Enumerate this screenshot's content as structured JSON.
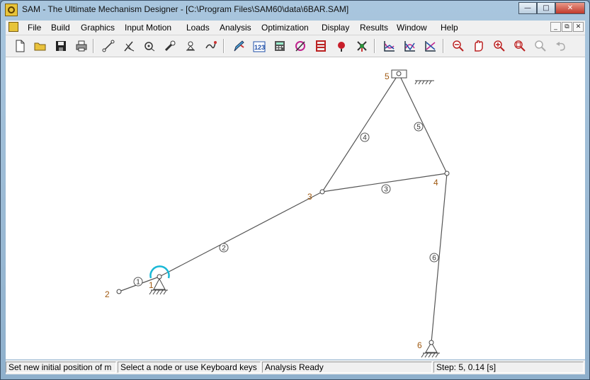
{
  "window": {
    "title": "SAM - The Ultimate Mechanism Designer - [C:\\Program Files\\SAM60\\data\\6BAR.SAM]"
  },
  "menu": [
    "File",
    "Build",
    "Graphics",
    "Input Motion",
    "Loads",
    "Analysis",
    "Optimization",
    "Display",
    "Results",
    "Window",
    "Help"
  ],
  "toolbar_icons": [
    "new-file-icon",
    "open-folder-icon",
    "save-icon",
    "print-icon",
    "beam-icon",
    "slider-icon",
    "hinge-icon",
    "gear-icon",
    "ground-icon",
    "spring-icon",
    "pen-icon",
    "numbers-123-icon",
    "calculator-icon",
    "pulley-icon",
    "ladder-icon",
    "load-icon",
    "windmill-icon",
    "chart-1-icon",
    "chart-2-icon",
    "chart-3-icon",
    "zoom-out-icon",
    "pan-icon",
    "zoom-fit-icon",
    "zoom-window-icon",
    "zoom-previous-icon",
    "undo-icon"
  ],
  "mechanism": {
    "nodes": [
      {
        "label": "1",
        "pos": "lower"
      },
      {
        "label": "2",
        "pos": "left"
      },
      {
        "label": "3",
        "pos": "left"
      },
      {
        "label": "4",
        "pos": "lower"
      },
      {
        "label": "5",
        "pos": "left"
      },
      {
        "label": "6",
        "pos": "left"
      }
    ],
    "elements": [
      "1",
      "2",
      "3",
      "4",
      "5",
      "6"
    ]
  },
  "status": {
    "pane1": "Set new initial position of m",
    "pane2": "Select a node or use Keyboard keys",
    "pane3": "Analysis Ready",
    "pane4": "Step: 5,    0.14 [s]"
  }
}
